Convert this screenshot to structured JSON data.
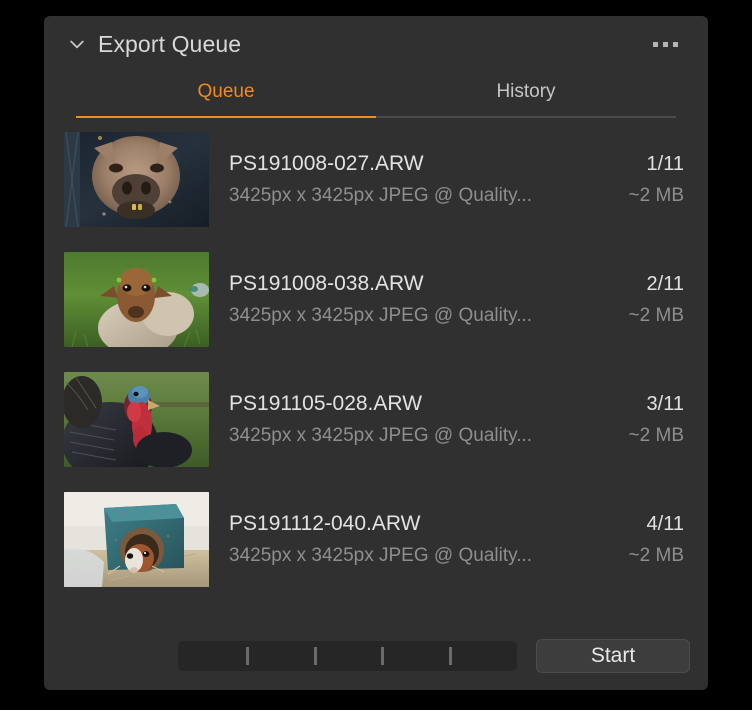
{
  "panel": {
    "title": "Export Queue",
    "collapse_icon": "chevron-down-icon",
    "overflow_icon": "ellipsis-icon"
  },
  "tabs": [
    {
      "label": "Queue",
      "active": true
    },
    {
      "label": "History",
      "active": false
    }
  ],
  "accent_color": "#f08b1e",
  "panel_background": "#303030",
  "queue": [
    {
      "filename": "PS191008-027.ARW",
      "settings": "3425px x 3425px JPEG @ Quality...",
      "index": "1/11",
      "size": "~2 MB",
      "thumbnail": "pig-portrait"
    },
    {
      "filename": "PS191008-038.ARW",
      "settings": "3425px x 3425px JPEG @ Quality...",
      "index": "2/11",
      "size": "~2 MB",
      "thumbnail": "sheep-on-grass"
    },
    {
      "filename": "PS191105-028.ARW",
      "settings": "3425px x 3425px JPEG @ Quality...",
      "index": "3/11",
      "size": "~2 MB",
      "thumbnail": "turkey-portrait"
    },
    {
      "filename": "PS191112-040.ARW",
      "settings": "3425px x 3425px JPEG @ Quality...",
      "index": "4/11",
      "size": "~2 MB",
      "thumbnail": "guinea-pig-in-box"
    }
  ],
  "footer": {
    "segments": 5,
    "start_label": "Start"
  }
}
